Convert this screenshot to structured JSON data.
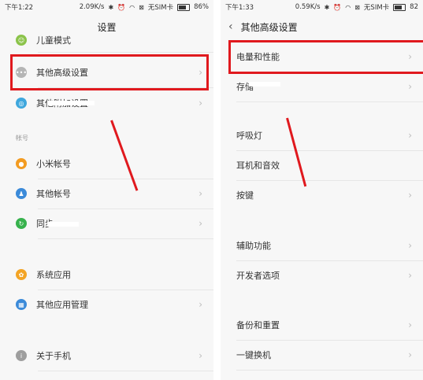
{
  "left": {
    "status": {
      "time": "下午1:22",
      "speed": "2.09K/s",
      "sim": "无SIM卡",
      "battery": "86%"
    },
    "title": "设置",
    "items": [
      {
        "label": "儿童模式",
        "icon_color": "#8bc34a"
      },
      {
        "label": "其他高级设置",
        "icon_color": "#a9a9a9"
      },
      {
        "label": "其他附加设置",
        "icon_color": "#3fa7dd"
      },
      {
        "label": "小米帐号",
        "icon_color": "#f39c22"
      },
      {
        "label": "其他帐号",
        "icon_color": "#3b8ad9"
      },
      {
        "label": "同步",
        "icon_color": "#37b24d"
      },
      {
        "label": "系统应用",
        "icon_color": "#f3a425"
      },
      {
        "label": "其他应用管理",
        "icon_color": "#3b8ad9"
      },
      {
        "label": "关于手机",
        "icon_color": "#9e9e9e"
      }
    ],
    "section_account": "帐号"
  },
  "right": {
    "status": {
      "time": "下午1:33",
      "speed": "0.59K/s",
      "sim": "无SIM卡",
      "battery": "82"
    },
    "title": "其他高级设置",
    "items": [
      {
        "label": "电量和性能"
      },
      {
        "label": "存储"
      },
      {
        "label": "呼吸灯"
      },
      {
        "label": "耳机和音效"
      },
      {
        "label": "按键"
      },
      {
        "label": "辅助功能"
      },
      {
        "label": "开发者选项"
      },
      {
        "label": "备份和重置"
      },
      {
        "label": "一键换机"
      }
    ]
  },
  "colors": {
    "highlight": "#e0191e"
  }
}
